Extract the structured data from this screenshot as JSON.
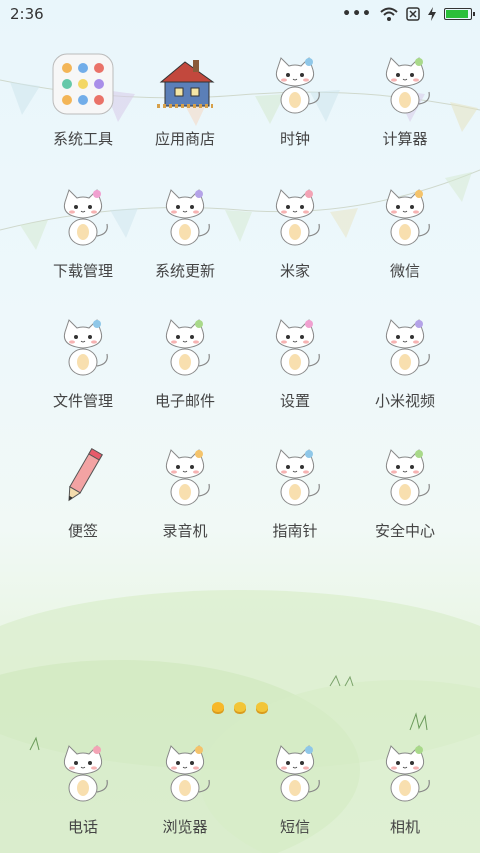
{
  "status_bar": {
    "time": "2:36",
    "battery_level": 1.0,
    "icons": [
      "more-dots-icon",
      "wifi-icon",
      "sim-off-icon",
      "charging-icon",
      "battery-icon"
    ]
  },
  "apps": [
    {
      "label": "系统工具",
      "icon": "folder-icon"
    },
    {
      "label": "应用商店",
      "icon": "store-house-icon"
    },
    {
      "label": "时钟",
      "icon": "clock-cat-icon"
    },
    {
      "label": "计算器",
      "icon": "calculator-cat-icon"
    },
    {
      "label": "下载管理",
      "icon": "download-cat-icon"
    },
    {
      "label": "系统更新",
      "icon": "update-cat-icon"
    },
    {
      "label": "米家",
      "icon": "mijia-cat-icon"
    },
    {
      "label": "微信",
      "icon": "wechat-cat-icon"
    },
    {
      "label": "文件管理",
      "icon": "files-cat-icon"
    },
    {
      "label": "电子邮件",
      "icon": "email-cat-icon"
    },
    {
      "label": "设置",
      "icon": "settings-cat-icon"
    },
    {
      "label": "小米视频",
      "icon": "video-cat-icon"
    },
    {
      "label": "便签",
      "icon": "notes-pencil-icon"
    },
    {
      "label": "录音机",
      "icon": "recorder-cat-icon"
    },
    {
      "label": "指南针",
      "icon": "compass-cat-icon"
    },
    {
      "label": "安全中心",
      "icon": "security-cat-icon"
    }
  ],
  "dock": [
    {
      "label": "电话",
      "icon": "phone-cat-icon"
    },
    {
      "label": "浏览器",
      "icon": "browser-cat-icon"
    },
    {
      "label": "短信",
      "icon": "messages-cat-icon"
    },
    {
      "label": "相机",
      "icon": "camera-cat-icon"
    }
  ],
  "page_indicator": {
    "pages": 3,
    "current": 1
  }
}
